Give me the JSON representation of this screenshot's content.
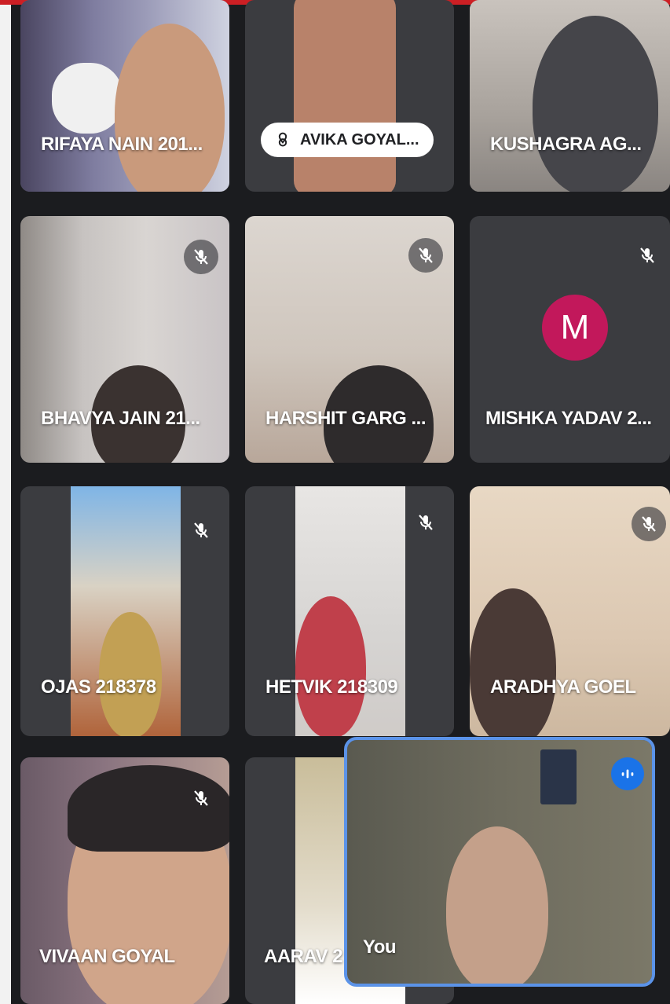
{
  "participants": [
    {
      "name": "RIFAYA NAIN 201...",
      "muted": false
    },
    {
      "name": "AVIKA GOYAL...",
      "muted": false,
      "pinned_label": true
    },
    {
      "name": "KUSHAGRA AG...",
      "muted": false
    },
    {
      "name": "BHAVYA JAIN 21...",
      "muted": true
    },
    {
      "name": "HARSHIT GARG ...",
      "muted": true
    },
    {
      "name": "MISHKA YADAV 2...",
      "muted": true,
      "avatar_letter": "M",
      "avatar_color": "#c2185b"
    },
    {
      "name": "OJAS 218378",
      "muted": true
    },
    {
      "name": "HETVIK 218309",
      "muted": true
    },
    {
      "name": "ARADHYA GOEL",
      "muted": true
    },
    {
      "name": "VIVAAN GOYAL",
      "muted": true
    },
    {
      "name": "AARAV 2",
      "muted": false
    }
  ],
  "self_view": {
    "name": "You",
    "speaking": true
  },
  "colors": {
    "accent_blue": "#1a73e8",
    "self_border": "#5b93e8",
    "top_bar": "#cc1f24"
  }
}
